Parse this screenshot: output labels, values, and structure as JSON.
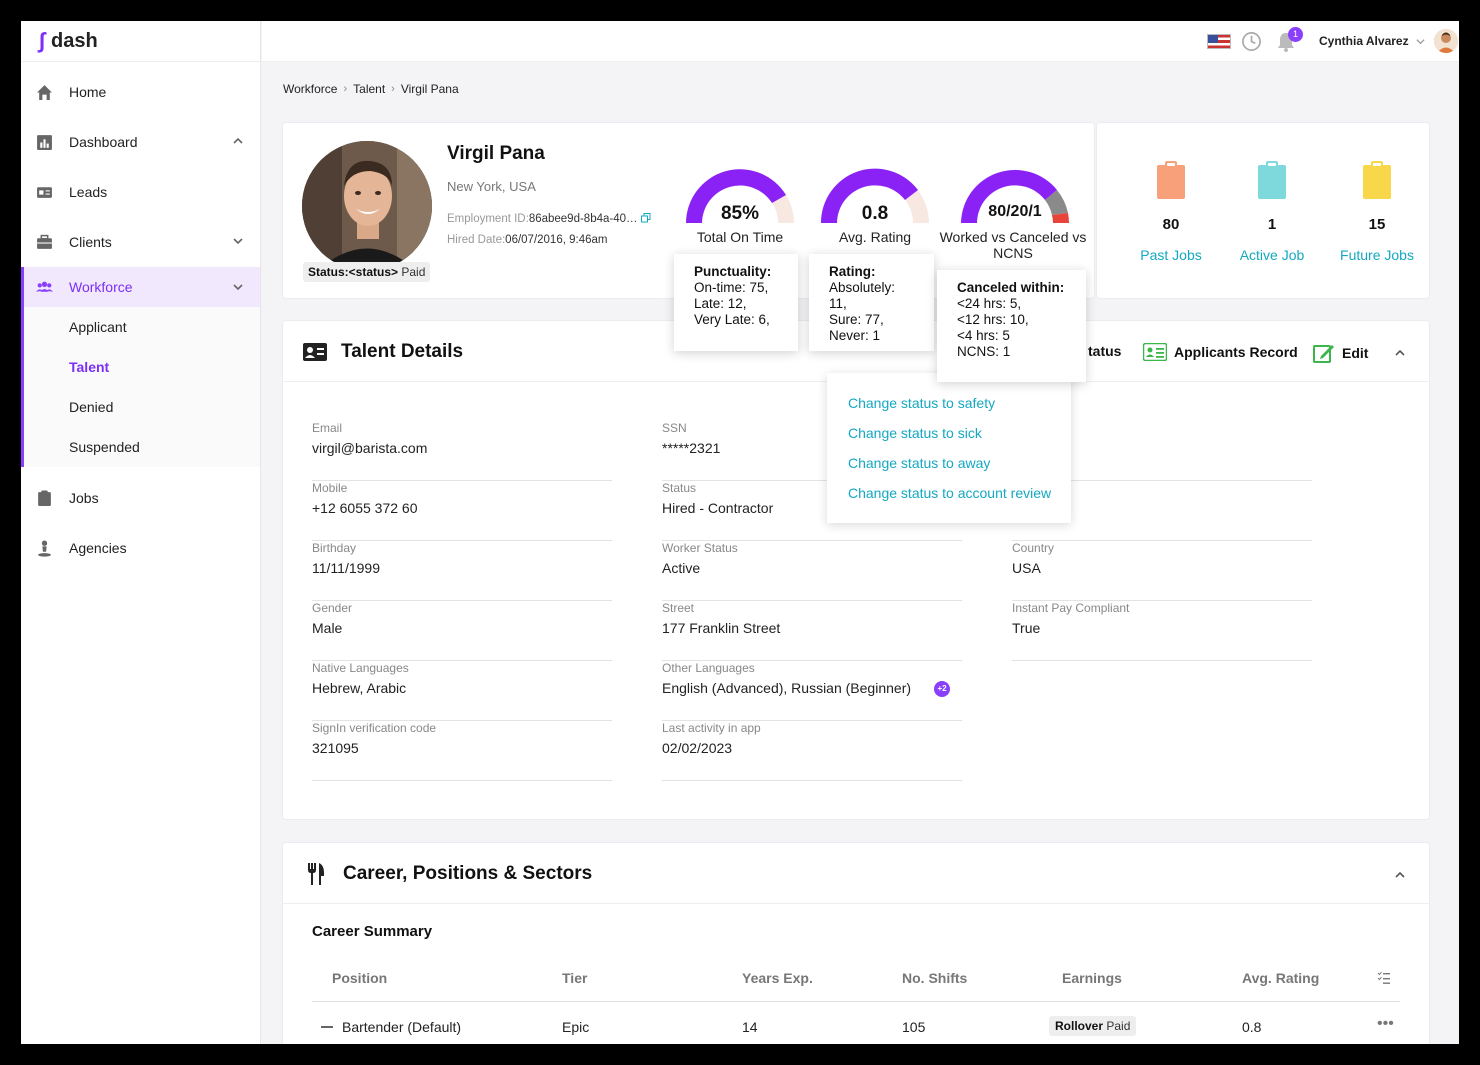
{
  "app": {
    "name": "dash"
  },
  "sidebar": {
    "items": [
      {
        "label": "Home"
      },
      {
        "label": "Dashboard"
      },
      {
        "label": "Leads"
      },
      {
        "label": "Clients"
      },
      {
        "label": "Workforce"
      },
      {
        "label": "Jobs"
      },
      {
        "label": "Agencies"
      }
    ],
    "workforce_sub": [
      {
        "label": "Applicant"
      },
      {
        "label": "Talent"
      },
      {
        "label": "Denied"
      },
      {
        "label": "Suspended"
      }
    ]
  },
  "topbar": {
    "notifications": "1",
    "user_name": "Cynthia Alvarez"
  },
  "breadcrumb": [
    "Workforce",
    "Talent",
    "Virgil Pana"
  ],
  "profile": {
    "name": "Virgil Pana",
    "location": "New York, USA",
    "employment_label": "Employment ID:",
    "employment_id": "86abee9d-8b4a-40…",
    "hired_label": "Hired Date:",
    "hired_date": "06/07/2016, 9:46am",
    "status_label": "Status:<status>",
    "status_value": "Paid"
  },
  "gauges": [
    {
      "value": "85%",
      "label": "Total On Time",
      "fraction": 0.85
    },
    {
      "value": "0.8",
      "label": "Avg. Rating",
      "fraction": 0.8
    },
    {
      "value": "80/20/1",
      "label": "Worked vs Canceled vs NCNS",
      "fraction": 0.79
    }
  ],
  "tooltips": {
    "punctuality": {
      "title": "Punctuality:",
      "lines": [
        "On-time: 75,",
        "Late: 12,",
        "Very Late: 6,"
      ]
    },
    "rating": {
      "title": "Rating:",
      "lines": [
        "Absolutely: 11,",
        "Sure: 77,",
        "Never: 1"
      ]
    },
    "canceled": {
      "title": "Canceled within:",
      "lines": [
        "<24 hrs: 5,",
        "<12 hrs: 10,",
        "<4 hrs: 5",
        "NCNS: 1"
      ]
    }
  },
  "job_stats": [
    {
      "value": "80",
      "label": "Past Jobs",
      "color": "#f8a07a"
    },
    {
      "value": "1",
      "label": "Active Job",
      "color": "#7dd9dc"
    },
    {
      "value": "15",
      "label": "Future Jobs",
      "color": "#f8d74a"
    }
  ],
  "talent_details": {
    "title": "Talent Details",
    "actions": {
      "status": "tatus",
      "applicants_record": "Applicants Record",
      "edit": "Edit"
    },
    "status_menu": [
      "Change status to safety",
      "Change status to sick",
      "Change status to away",
      "Change status to account review"
    ],
    "fields": {
      "email": {
        "label": "Email",
        "value": "virgil@barista.com"
      },
      "mobile": {
        "label": "Mobile",
        "value": "+12 6055 372 60"
      },
      "birthday": {
        "label": "Birthday",
        "value": "11/11/1999"
      },
      "gender": {
        "label": "Gender",
        "value": "Male"
      },
      "native_languages": {
        "label": "Native Languages",
        "value": "Hebrew, Arabic"
      },
      "signin_code": {
        "label": "SignIn verification code",
        "value": "321095"
      },
      "ssn": {
        "label": "SSN",
        "value": "*****2321"
      },
      "status": {
        "label": "Status",
        "value": "Hired - Contractor"
      },
      "worker_status": {
        "label": "Worker Status",
        "value": "Active"
      },
      "street": {
        "label": "Street",
        "value": "177 Franklin Street"
      },
      "other_languages": {
        "label": "Other Languages",
        "value": "English (Advanced), Russian (Beginner)",
        "more": "+2"
      },
      "last_activity": {
        "label": "Last activity in app",
        "value": "02/02/2023"
      },
      "country": {
        "label": "Country",
        "value": "USA"
      },
      "instant_pay": {
        "label": "Instant Pay Compliant",
        "value": "True"
      }
    }
  },
  "career": {
    "title": "Career, Positions & Sectors",
    "summary_title": "Career Summary",
    "columns": [
      "Position",
      "Tier",
      "Years Exp.",
      "No. Shifts",
      "Earnings",
      "Avg. Rating"
    ],
    "rows": [
      {
        "position": "Bartender (Default)",
        "tier": "Epic",
        "years": "14",
        "shifts": "105",
        "earnings_label": "Rollover",
        "earnings_value": "Paid",
        "rating": "0.8"
      }
    ]
  }
}
